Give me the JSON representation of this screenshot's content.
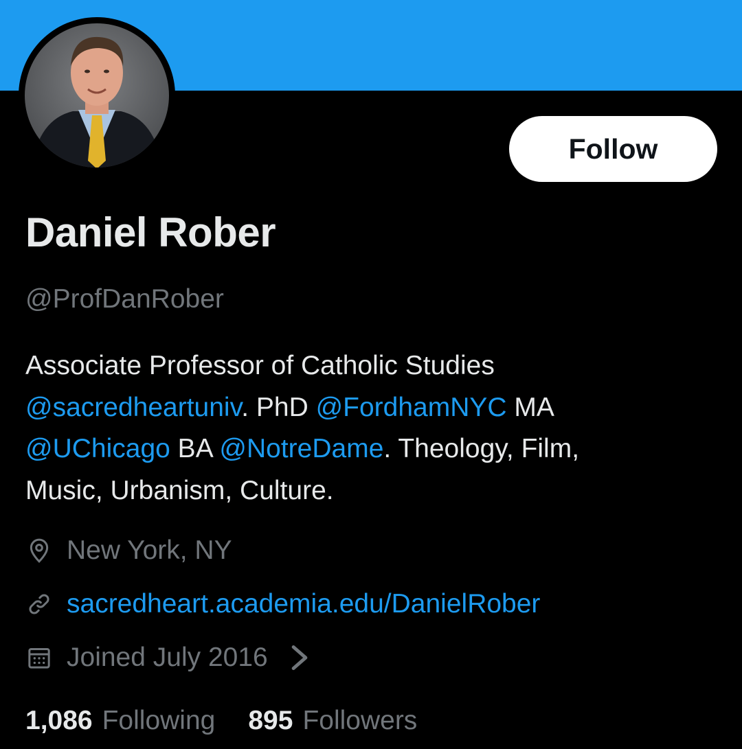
{
  "profile": {
    "display_name": "Daniel Rober",
    "handle": "@ProfDanRober",
    "follow_label": "Follow"
  },
  "bio": {
    "line1": "Associate Professor of Catholic Studies",
    "mention_sacredheart": "@sacredheartuniv",
    "text_phd": ". PhD ",
    "mention_fordham": "@FordhamNYC",
    "text_ma": " MA",
    "mention_uchicago": "@UChicago",
    "text_ba": " BA ",
    "mention_notredame": "@NotreDame",
    "text_tail": ". Theology, Film,",
    "line4": "Music, Urbanism, Culture."
  },
  "meta": {
    "location": "New York, NY",
    "website": "sacredheart.academia.edu/DanielRober",
    "joined": "Joined July 2016"
  },
  "stats": {
    "following_count": "1,086",
    "following_label": "Following",
    "followers_count": "895",
    "followers_label": "Followers"
  },
  "colors": {
    "banner": "#1d9bf0",
    "background": "#000000",
    "link": "#1d9bf0",
    "secondary_text": "#71767b",
    "primary_text": "#e7e9ea"
  },
  "icons": {
    "location": "map-pin-icon",
    "website": "link-icon",
    "joined": "calendar-icon",
    "more": "chevron-right-icon"
  }
}
